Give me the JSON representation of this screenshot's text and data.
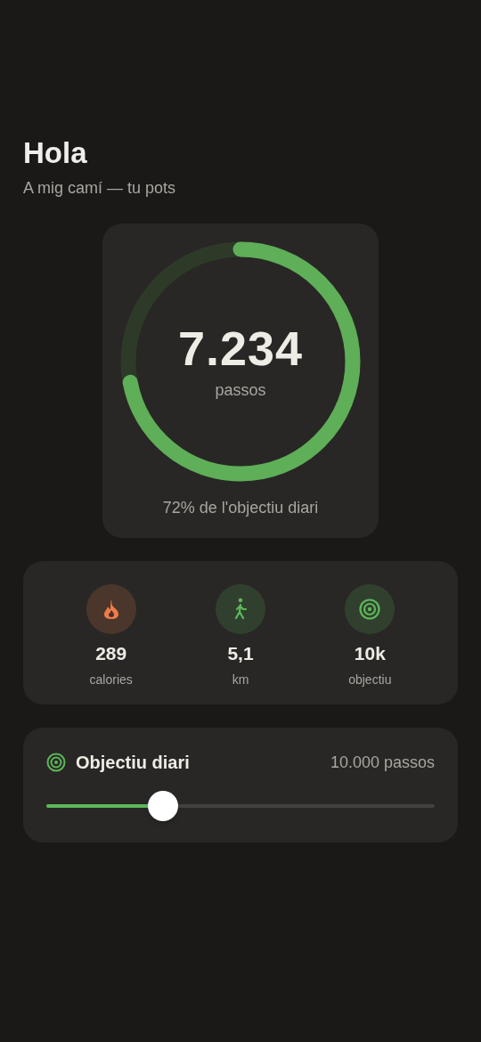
{
  "header": {
    "title": "Hola",
    "subtitle": "A mig camí — tu pots"
  },
  "steps_card": {
    "value": "7.234",
    "unit": "passos",
    "caption": "72% de l'objectiu diari"
  },
  "stats": [
    {
      "kind": "calories",
      "color": "#ee7d4a",
      "value": "289",
      "label": "calories"
    },
    {
      "kind": "distance",
      "color": "#5cb85a",
      "value": "5,1",
      "label": "km"
    },
    {
      "kind": "goal",
      "color": "#5cb85a",
      "value": "10k",
      "label": "objectiu"
    }
  ],
  "goal": {
    "title": "Objectiu diari",
    "value": "10.000 passos",
    "level": 0.3
  }
}
